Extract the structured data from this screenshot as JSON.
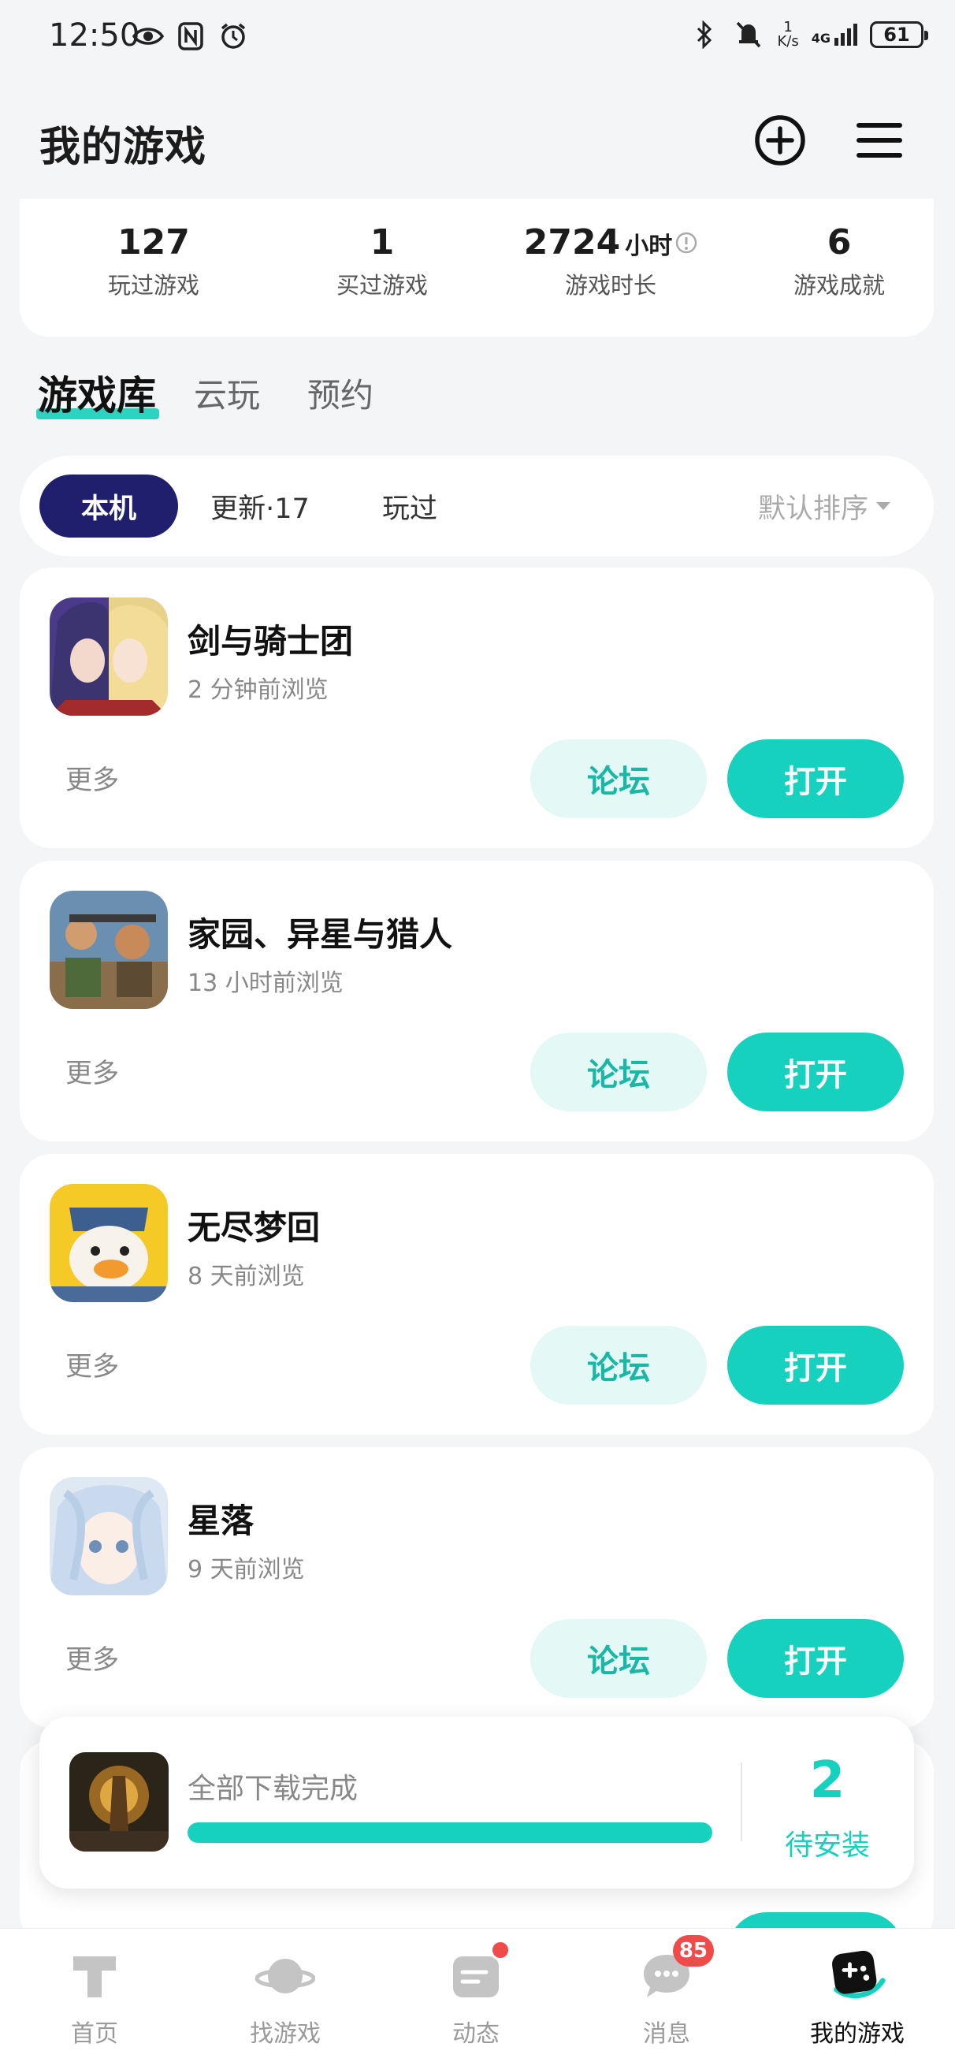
{
  "status_bar": {
    "time": "12:50",
    "net_speed_value": "1",
    "net_speed_unit": "K/s",
    "network": "4G",
    "battery": "61"
  },
  "header": {
    "title": "我的游戏"
  },
  "stats": [
    {
      "value": "127",
      "unit": "",
      "label": "玩过游戏"
    },
    {
      "value": "1",
      "unit": "",
      "label": "买过游戏"
    },
    {
      "value": "2724",
      "unit": "小时",
      "label": "游戏时长"
    },
    {
      "value": "6",
      "unit": "",
      "label": "游戏成就"
    }
  ],
  "main_tabs": [
    "游戏库",
    "云玩",
    "预约"
  ],
  "filters": {
    "local": "本机",
    "updates": "更新·17",
    "played": "玩过",
    "sort": "默认排序"
  },
  "games": [
    {
      "name": "剑与骑士团",
      "viewed": "2 分钟前浏览",
      "more": "更多",
      "forum": "论坛",
      "open": "打开"
    },
    {
      "name": "家园、异星与猎人",
      "viewed": "13 小时前浏览",
      "more": "更多",
      "forum": "论坛",
      "open": "打开"
    },
    {
      "name": "无尽梦回",
      "viewed": "8 天前浏览",
      "more": "更多",
      "forum": "论坛",
      "open": "打开"
    },
    {
      "name": "星落",
      "viewed": "9 天前浏览",
      "more": "更多",
      "forum": "论坛",
      "open": "打开"
    }
  ],
  "download": {
    "text": "全部下载完成",
    "progress": 1.0,
    "count": "2",
    "label": "待安装"
  },
  "bottom_nav": [
    {
      "label": "首页"
    },
    {
      "label": "找游戏"
    },
    {
      "label": "动态"
    },
    {
      "label": "消息",
      "badge": "85"
    },
    {
      "label": "我的游戏"
    }
  ],
  "colors": {
    "accent": "#16d1bd",
    "chip_active": "#1f1f6e",
    "badge": "#f04b4b"
  }
}
